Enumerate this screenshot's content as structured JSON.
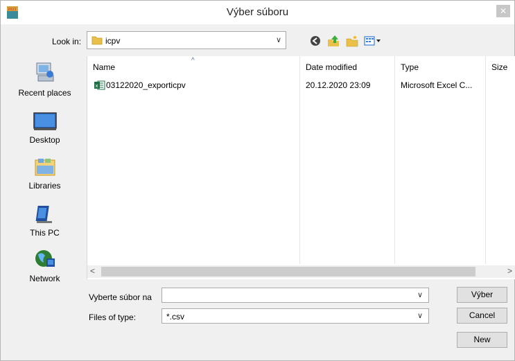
{
  "window": {
    "title": "Výber súboru",
    "close_glyph": "✕",
    "app_icon_text": "2021"
  },
  "lookin": {
    "label": "Look in:",
    "value": "icpv",
    "arrow": "∨"
  },
  "places": [
    {
      "label": "Recent places"
    },
    {
      "label": "Desktop"
    },
    {
      "label": "Libraries"
    },
    {
      "label": "This PC"
    },
    {
      "label": "Network"
    }
  ],
  "filelist": {
    "columns": [
      "Name",
      "Date modified",
      "Type",
      "Size"
    ],
    "sort_glyph": "^",
    "rows": [
      {
        "name": "03122020_exporticpv",
        "date": "20.12.2020 23:09",
        "type": "Microsoft Excel C...",
        "icon": "excel-csv-icon"
      }
    ]
  },
  "scroll": {
    "left": "<",
    "right": ">"
  },
  "filename": {
    "label": "Vyberte súbor na",
    "value": "",
    "arrow": "∨"
  },
  "filetype": {
    "label": "Files of type:",
    "value": "*.csv",
    "arrow": "∨"
  },
  "buttons": {
    "select": "Výber",
    "cancel": "Cancel",
    "new": "New"
  },
  "colors": {
    "accent_icon_green": "#1e7145",
    "folder_yellow": "#e8c04a"
  }
}
